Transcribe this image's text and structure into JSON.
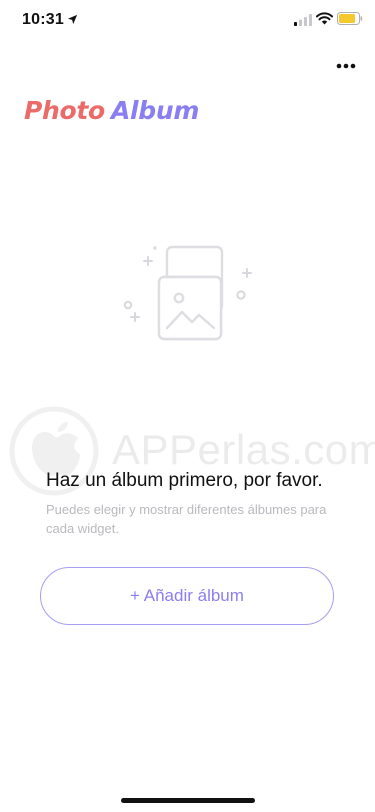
{
  "status_bar": {
    "time": "10:31",
    "icons": [
      "location-arrow-icon",
      "cellular-signal-icon",
      "wifi-icon",
      "battery-icon"
    ],
    "battery_color": "#f5c92e"
  },
  "header": {
    "menu_icon": "more-horizontal-icon",
    "title_part1": "Photo",
    "title_part2": "Album",
    "title_color_1": "#ea6b67",
    "title_color_2": "#8a7ff0"
  },
  "empty_state": {
    "illustration_icon": "stacked-photos-icon",
    "heading": "Haz un álbum primero, por favor.",
    "subtext": "Puedes elegir y mostrar diferentes álbumes para cada widget."
  },
  "actions": {
    "add_album_label": "+ Añadir álbum",
    "accent_color": "#8a7ff0"
  },
  "watermark": {
    "text": "APPerlas.com"
  }
}
